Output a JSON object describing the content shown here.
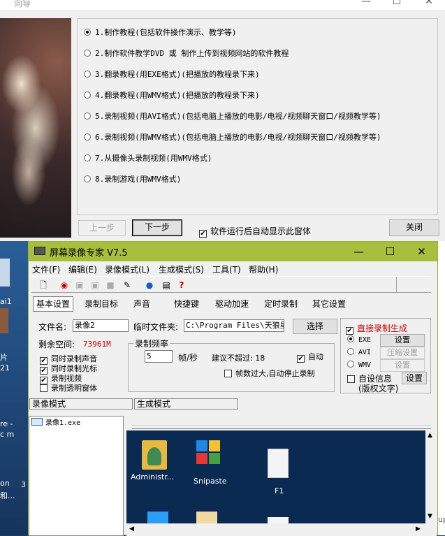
{
  "wizard": {
    "title": "向导",
    "caption_buttons": [
      "—",
      "☐",
      "✕"
    ],
    "options": [
      {
        "label": "1.制作教程(包括软件操作演示、教学等)",
        "selected": true
      },
      {
        "label": "2.制作软件教学DVD 或 制作上传到视频网站的软件教程",
        "selected": false
      },
      {
        "label": "3.翻录教程(用EXE格式)(把播放的教程录下来)",
        "selected": false
      },
      {
        "label": "4.翻录教程(用WMV格式)(把播放的教程录下来)",
        "selected": false
      },
      {
        "label": "5.录制视频(用AVI格式)(包括电脑上播放的电影/电视/视频聊天窗口/视频教学等)",
        "selected": false
      },
      {
        "label": "6.录制视频(用WMV格式)(包括电脑上播放的电影/电视/视频聊天窗口/视频教学等)",
        "selected": false
      },
      {
        "label": "7.从摄像头录制视频(用WMV格式)",
        "selected": false
      },
      {
        "label": "8.录制游戏(用WMV格式)",
        "selected": false
      }
    ],
    "prev_label": "上一步",
    "next_label": "下一步",
    "autoshow_label": "软件运行后自动显示此窗体",
    "autoshow_checked": true,
    "close_label": "关闭"
  },
  "desktop": {
    "left_texts": [
      "ai1",
      "21",
      "片",
      "re -",
      "c m",
      "on",
      "和...",
      "3"
    ],
    "right_text": "up"
  },
  "main": {
    "title": "屏幕录像专家 V7.5",
    "caption_buttons": [
      "—",
      "☐",
      "✕"
    ],
    "menu": [
      "文件(F)",
      "编辑(E)",
      "录像模式(L)",
      "生成模式(S)",
      "工具(T)",
      "帮助(H)"
    ],
    "toolbar_icons": [
      "new-file-icon",
      "record-icon",
      "pause-icon",
      "stop-icon",
      "camera-icon",
      "brush-icon",
      "globe-icon",
      "photo-icon",
      "help-icon"
    ],
    "tabs": [
      "基本设置",
      "录制目标",
      "声音",
      "快捷键",
      "驱动加速",
      "定时录制",
      "其它设置"
    ],
    "active_tab": 0,
    "filename_label": "文件名:",
    "filename_value": "录像2",
    "tempdir_label": "临时文件夹:",
    "tempdir_value": "C:\\Program Files\\天狼星",
    "browse_label": "选择",
    "freespace_label": "剩余空间:",
    "freespace_value": "73961M",
    "record_options": [
      {
        "label": "同时录制声音",
        "checked": true
      },
      {
        "label": "同时录制光标",
        "checked": true
      },
      {
        "label": "录制视频",
        "checked": true
      },
      {
        "label": "录制透明窗体",
        "checked": false
      }
    ],
    "framerate_title": "录制频率",
    "framerate_value": "5",
    "framerate_unit": "帧/秒",
    "suggest_label": "建议不超过: 18",
    "auto_label": "自动",
    "auto_checked": true,
    "autostop_label": "帧数过大,自动停止录制",
    "autostop_checked": false,
    "direct_gen_label": "直接录制生成",
    "direct_gen_checked": true,
    "formats": [
      {
        "label": "EXE",
        "selected": true,
        "button": "设置",
        "enabled": true
      },
      {
        "label": "AVI",
        "selected": false,
        "button": "压缩设置",
        "enabled": false
      },
      {
        "label": "WMV",
        "selected": false,
        "button": "设置",
        "enabled": false
      }
    ],
    "custom_info_label": "自设信息",
    "custom_info_sub": "(版权文字)",
    "custom_info_checked": false,
    "custom_info_button": "设置",
    "record_mode_label": "录像模式",
    "gen_mode_label": "生成模式",
    "files": [
      "录像1.exe"
    ],
    "preview_icons": [
      {
        "name": "Administr...",
        "icon": "user-folder-icon"
      },
      {
        "name": "Snipaste",
        "icon": "snipaste-icon"
      },
      {
        "name": "F1",
        "icon": "document-icon"
      }
    ]
  }
}
